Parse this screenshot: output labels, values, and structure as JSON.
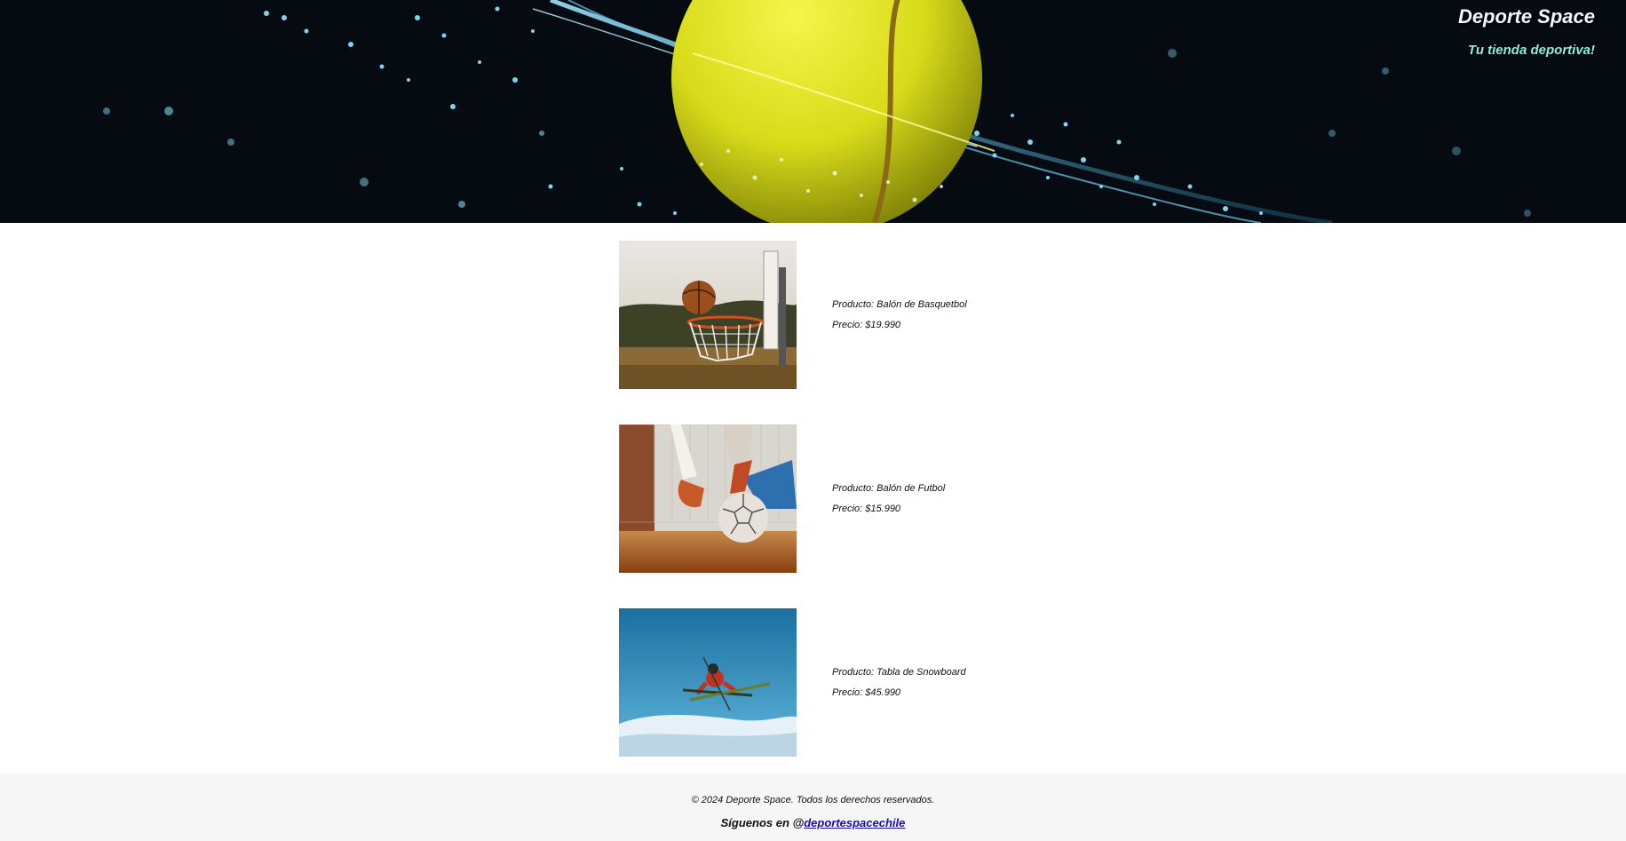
{
  "header": {
    "title": "Deporte Space",
    "tagline": "Tu tienda deportiva!"
  },
  "products": [
    {
      "name_label": "Producto: Balón de Basquetbol",
      "price_label": "Precio: $19.990",
      "image_icon": "basketball-hoop-image"
    },
    {
      "name_label": "Producto: Balón de Futbol",
      "price_label": "Precio: $15.990",
      "image_icon": "soccer-ball-image"
    },
    {
      "name_label": "Producto: Tabla de Snowboard",
      "price_label": "Precio: $45.990",
      "image_icon": "skier-jump-image"
    }
  ],
  "footer": {
    "copyright": "© 2024 Deporte Space. Todos los derechos reservados.",
    "follow_prefix": "Síguenos en @",
    "social_handle": "deportespacechile"
  },
  "colors": {
    "header_bg": "#050b10",
    "title": "#f2f6ff",
    "tagline": "#8ff0d8",
    "link": "#1a0dab",
    "footer_bg": "#f6f6f6"
  }
}
